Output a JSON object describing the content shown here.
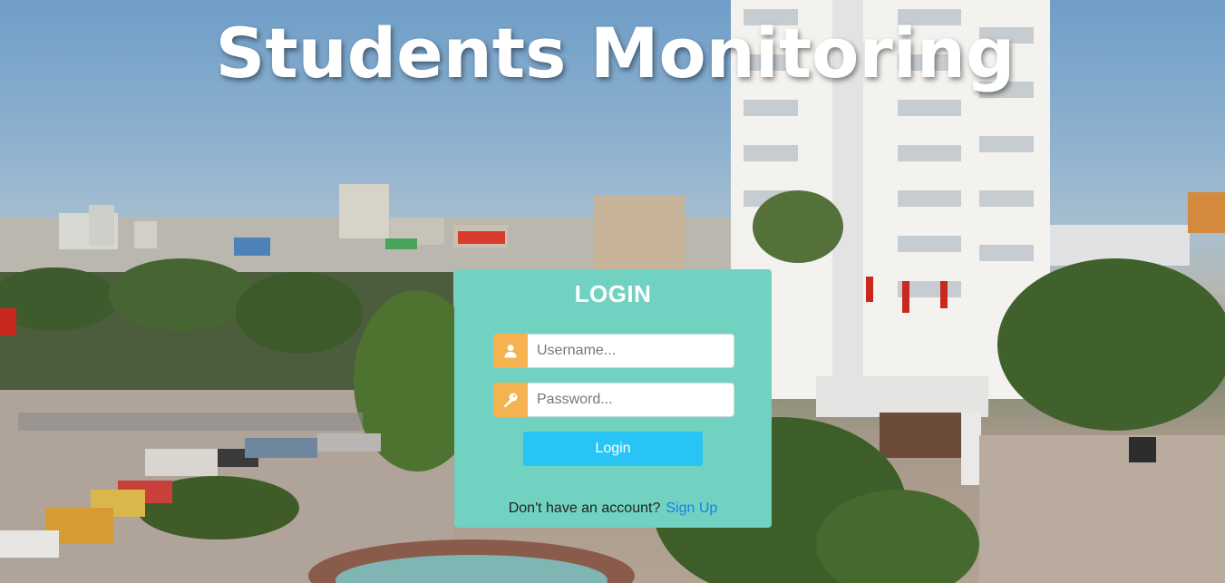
{
  "page": {
    "title": "Students Monitoring"
  },
  "login": {
    "heading": "LOGIN",
    "username_placeholder": "Username...",
    "password_placeholder": "Password...",
    "button_label": "Login",
    "signup_prompt": "Don't have an account?",
    "signup_link": "Sign Up"
  },
  "colors": {
    "card": "#72d2c2",
    "addon": "#f4b350",
    "button": "#27c4f5",
    "link": "#1a7fe0"
  },
  "icons": {
    "username": "user-icon",
    "password": "key-icon"
  }
}
